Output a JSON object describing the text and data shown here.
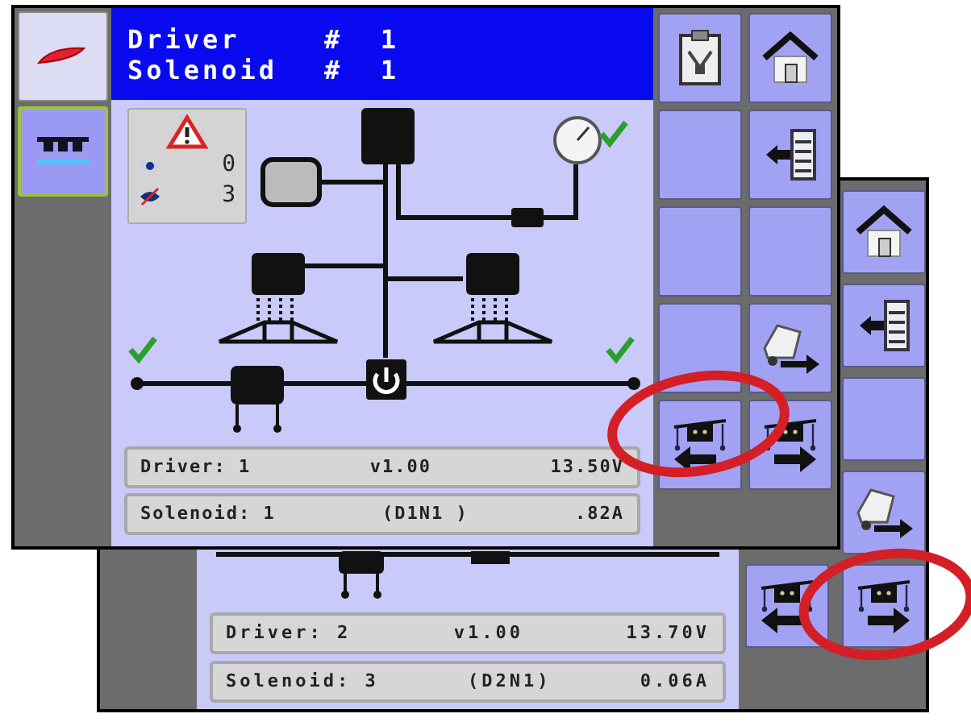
{
  "front_screen": {
    "sidebar": [
      {
        "kind": "logo",
        "selected": false
      },
      {
        "kind": "boom",
        "selected": true
      }
    ],
    "header": [
      {
        "label": "Driver",
        "number": "#  1"
      },
      {
        "label": "Solenoid",
        "number": "#  1"
      }
    ],
    "alarms": [
      {
        "kind": "visible",
        "count": "0"
      },
      {
        "kind": "hidden",
        "count": "3"
      }
    ],
    "info_rows": [
      {
        "cells": [
          "Driver: 1",
          "v1.00",
          "13.50V"
        ]
      },
      {
        "cells": [
          "Solenoid: 1",
          "(D1N1 )",
          ".82A"
        ]
      }
    ],
    "buttons": [
      {
        "kind": "clipboard"
      },
      {
        "kind": "home"
      },
      {
        "kind": "blank"
      },
      {
        "kind": "list"
      },
      {
        "kind": "blank"
      },
      {
        "kind": "blank"
      },
      {
        "kind": "blank"
      },
      {
        "kind": "truck"
      },
      {
        "kind": "steer-left"
      },
      {
        "kind": "steer-right"
      }
    ]
  },
  "back_screen": {
    "info_rows": [
      {
        "cells": [
          "Driver: 2",
          "v1.00",
          "13.70V"
        ]
      },
      {
        "cells": [
          "Solenoid: 3",
          "(D2N1)",
          "0.06A"
        ]
      }
    ],
    "buttons": [
      {
        "kind": "home"
      },
      {
        "kind": "list"
      },
      {
        "kind": "blank"
      },
      {
        "kind": "truck"
      },
      {
        "kind": "steer-left"
      },
      {
        "kind": "steer-right"
      }
    ]
  }
}
